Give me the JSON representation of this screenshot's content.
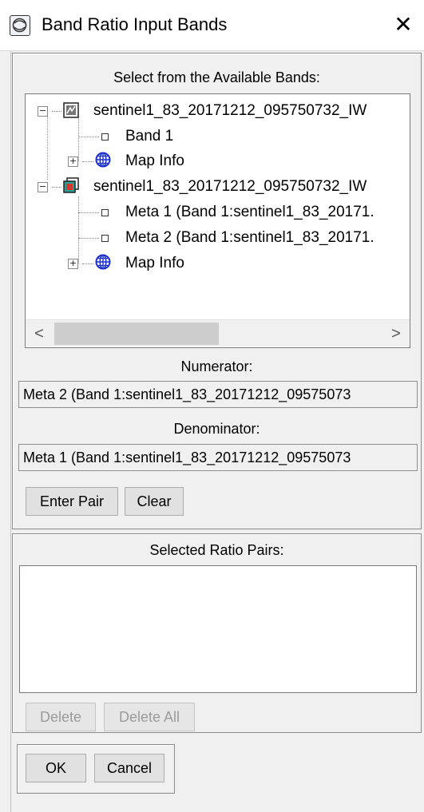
{
  "window": {
    "title": "Band Ratio Input Bands",
    "close_glyph": "✕"
  },
  "available": {
    "label": "Select from the Available Bands:",
    "tree": [
      {
        "text": "sentinel1_83_20171212_095750732_IW",
        "icon": "raster-file-icon"
      },
      {
        "text": "Band 1",
        "icon": "band-leaf-icon"
      },
      {
        "text": "Map Info",
        "icon": "globe-icon"
      },
      {
        "text": "sentinel1_83_20171212_095750732_IW",
        "icon": "raster-stack-icon"
      },
      {
        "text": "Meta 1 (Band 1:sentinel1_83_20171.",
        "icon": "band-leaf-icon"
      },
      {
        "text": "Meta 2 (Band 1:sentinel1_83_20171.",
        "icon": "band-leaf-icon"
      },
      {
        "text": "Map Info",
        "icon": "globe-icon"
      }
    ],
    "scroll_left": "<",
    "scroll_right": ">"
  },
  "numerator": {
    "label": "Numerator:",
    "value": "Meta 2 (Band 1:sentinel1_83_20171212_09575073"
  },
  "denominator": {
    "label": "Denominator:",
    "value": "Meta 1 (Band 1:sentinel1_83_20171212_09575073"
  },
  "pair_buttons": {
    "enter_pair": "Enter Pair",
    "clear": "Clear"
  },
  "selected": {
    "label": "Selected Ratio Pairs:",
    "items": [],
    "delete": "Delete",
    "delete_all": "Delete All"
  },
  "footer": {
    "ok": "OK",
    "cancel": "Cancel"
  }
}
